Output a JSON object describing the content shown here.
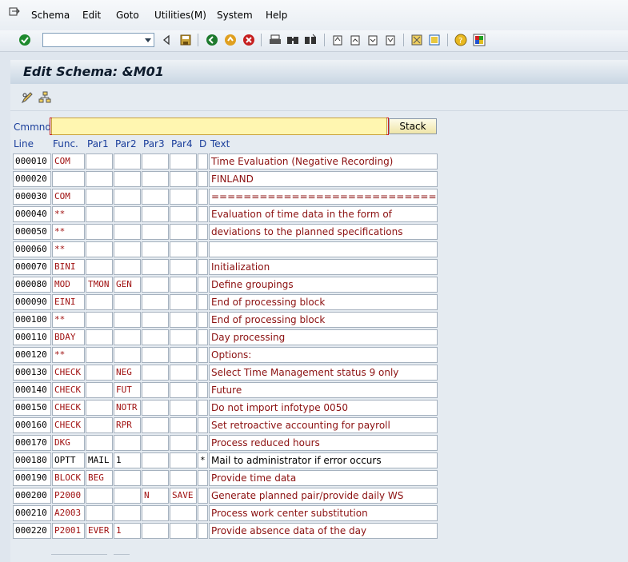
{
  "menu": [
    "Schema",
    "Edit",
    "Goto",
    "Utilities(M)",
    "System",
    "Help"
  ],
  "title": "Edit Schema: &M01",
  "command": {
    "label": "Cmmnd",
    "value": "",
    "stack_label": "Stack"
  },
  "columns": [
    "Line",
    "Func.",
    "Par1",
    "Par2",
    "Par3",
    "Par4",
    "D",
    "Text"
  ],
  "rows": [
    {
      "line": "000010",
      "func": "COM",
      "p1": "",
      "p2": "",
      "p3": "",
      "p4": "",
      "d": "",
      "text": "Time Evaluation (Negative Recording)"
    },
    {
      "line": "000020",
      "func": "",
      "p1": "",
      "p2": "",
      "p3": "",
      "p4": "",
      "d": "",
      "text": "FINLAND"
    },
    {
      "line": "000030",
      "func": "COM",
      "p1": "",
      "p2": "",
      "p3": "",
      "p4": "",
      "d": "",
      "text": "=================================="
    },
    {
      "line": "000040",
      "func": "**",
      "p1": "",
      "p2": "",
      "p3": "",
      "p4": "",
      "d": "",
      "text": "Evaluation of time data in the form of"
    },
    {
      "line": "000050",
      "func": "**",
      "p1": "",
      "p2": "",
      "p3": "",
      "p4": "",
      "d": "",
      "text": "deviations to the planned specifications"
    },
    {
      "line": "000060",
      "func": "**",
      "p1": "",
      "p2": "",
      "p3": "",
      "p4": "",
      "d": "",
      "text": ""
    },
    {
      "line": "000070",
      "func": "BINI",
      "p1": "",
      "p2": "",
      "p3": "",
      "p4": "",
      "d": "",
      "text": "Initialization"
    },
    {
      "line": "000080",
      "func": "MOD",
      "p1": "TMON",
      "p2": "GEN",
      "p3": "",
      "p4": "",
      "d": "",
      "text": "Define groupings"
    },
    {
      "line": "000090",
      "func": "EINI",
      "p1": "",
      "p2": "",
      "p3": "",
      "p4": "",
      "d": "",
      "text": "End of processing block"
    },
    {
      "line": "000100",
      "func": "**",
      "p1": "",
      "p2": "",
      "p3": "",
      "p4": "",
      "d": "",
      "text": "End of processing block"
    },
    {
      "line": "000110",
      "func": "BDAY",
      "p1": "",
      "p2": "",
      "p3": "",
      "p4": "",
      "d": "",
      "text": "Day processing"
    },
    {
      "line": "000120",
      "func": "**",
      "p1": "",
      "p2": "",
      "p3": "",
      "p4": "",
      "d": "",
      "text": "Options:"
    },
    {
      "line": "000130",
      "func": "CHECK",
      "p1": "",
      "p2": "NEG",
      "p3": "",
      "p4": "",
      "d": "",
      "text": "Select Time Management status 9 only"
    },
    {
      "line": "000140",
      "func": "CHECK",
      "p1": "",
      "p2": "FUT",
      "p3": "",
      "p4": "",
      "d": "",
      "text": "Future"
    },
    {
      "line": "000150",
      "func": "CHECK",
      "p1": "",
      "p2": "NOTR",
      "p3": "",
      "p4": "",
      "d": "",
      "text": "Do not import infotype 0050"
    },
    {
      "line": "000160",
      "func": "CHECK",
      "p1": "",
      "p2": "RPR",
      "p3": "",
      "p4": "",
      "d": "",
      "text": "Set retroactive accounting for payroll"
    },
    {
      "line": "000170",
      "func": "DKG",
      "p1": "",
      "p2": "",
      "p3": "",
      "p4": "",
      "d": "",
      "text": "Process reduced hours"
    },
    {
      "line": "000180",
      "func": "OPTT",
      "p1": "MAIL",
      "p2": "1",
      "p3": "",
      "p4": "",
      "d": "*",
      "text": "Mail to administrator if error occurs"
    },
    {
      "line": "000190",
      "func": "BLOCK",
      "p1": "BEG",
      "p2": "",
      "p3": "",
      "p4": "",
      "d": "",
      "text": "Provide time data"
    },
    {
      "line": "000200",
      "func": "P2000",
      "p1": "",
      "p2": "",
      "p3": "N",
      "p4": "SAVE",
      "d": "",
      "text": "Generate planned pair/provide daily WS"
    },
    {
      "line": "000210",
      "func": "A2003",
      "p1": "",
      "p2": "",
      "p3": "",
      "p4": "",
      "d": "",
      "text": "Process work center substitution"
    },
    {
      "line": "000220",
      "func": "P2001",
      "p1": "EVER",
      "p2": "1",
      "p3": "",
      "p4": "",
      "d": "",
      "text": "Provide absence data of the day"
    }
  ],
  "black_rows": [
    "000180"
  ]
}
